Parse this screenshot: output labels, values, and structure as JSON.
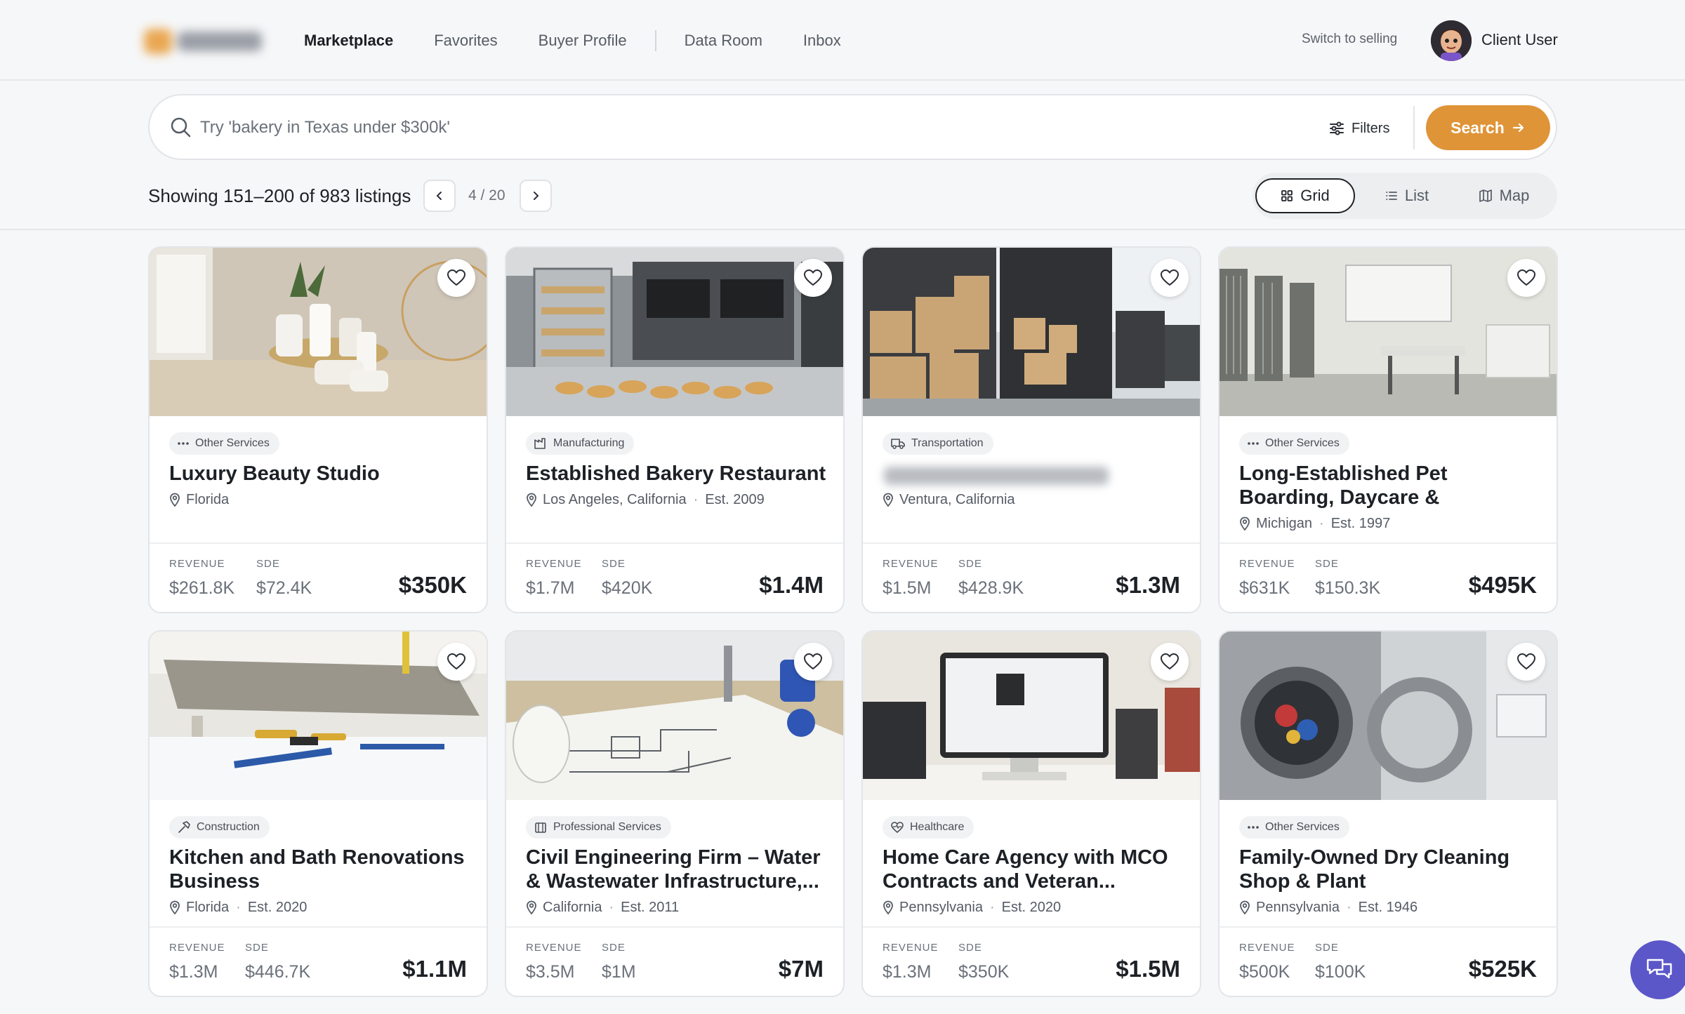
{
  "header": {
    "nav": [
      "Marketplace",
      "Favorites",
      "Buyer Profile",
      "Data Room",
      "Inbox"
    ],
    "switch_label": "Switch to selling",
    "user_name": "Client User"
  },
  "search": {
    "placeholder": "Try 'bakery in Texas under $300k'",
    "filters_label": "Filters",
    "button_label": "Search"
  },
  "results": {
    "showing": "Showing 151–200 of 983 listings",
    "page": "4 / 20",
    "views": [
      "Grid",
      "List",
      "Map"
    ],
    "active_view": "Grid"
  },
  "listings": [
    {
      "category": "Other Services",
      "title": "Luxury Beauty Studio",
      "location": "Florida",
      "established": "",
      "revenue_label": "REVENUE",
      "revenue": "$261.8K",
      "sde_label": "SDE",
      "sde": "$72.4K",
      "price": "$350K"
    },
    {
      "category": "Manufacturing",
      "title": "Established Bakery Restaurant",
      "location": "Los Angeles, California",
      "established": "Est. 2009",
      "revenue_label": "REVENUE",
      "revenue": "$1.7M",
      "sde_label": "SDE",
      "sde": "$420K",
      "price": "$1.4M"
    },
    {
      "category": "Transportation",
      "title": "",
      "location": "Ventura, California",
      "established": "",
      "revenue_label": "REVENUE",
      "revenue": "$1.5M",
      "sde_label": "SDE",
      "sde": "$428.9K",
      "price": "$1.3M"
    },
    {
      "category": "Other Services",
      "title": "Long-Established Pet Boarding, Daycare & Groomin...",
      "location": "Michigan",
      "established": "Est. 1997",
      "revenue_label": "REVENUE",
      "revenue": "$631K",
      "sde_label": "SDE",
      "sde": "$150.3K",
      "price": "$495K"
    },
    {
      "category": "Construction",
      "title": "Kitchen and Bath Renovations Business",
      "location": "Florida",
      "established": "Est. 2020",
      "revenue_label": "REVENUE",
      "revenue": "$1.3M",
      "sde_label": "SDE",
      "sde": "$446.7K",
      "price": "$1.1M"
    },
    {
      "category": "Professional Services",
      "title": "Civil Engineering Firm – Water & Wastewater Infrastructure,...",
      "location": "California",
      "established": "Est. 2011",
      "revenue_label": "REVENUE",
      "revenue": "$3.5M",
      "sde_label": "SDE",
      "sde": "$1M",
      "price": "$7M"
    },
    {
      "category": "Healthcare",
      "title": "Home Care Agency with MCO Contracts and Veteran...",
      "location": "Pennsylvania",
      "established": "Est. 2020",
      "revenue_label": "REVENUE",
      "revenue": "$1.3M",
      "sde_label": "SDE",
      "sde": "$350K",
      "price": "$1.5M"
    },
    {
      "category": "Other Services",
      "title": "Family-Owned Dry Cleaning Shop & Plant",
      "location": "Pennsylvania",
      "established": "Est. 1946",
      "revenue_label": "REVENUE",
      "revenue": "$500K",
      "sde_label": "SDE",
      "sde": "$100K",
      "price": "$525K"
    }
  ]
}
